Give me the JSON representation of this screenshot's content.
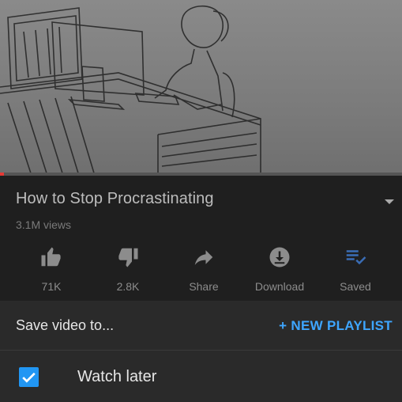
{
  "video": {
    "progress_percent": 1
  },
  "title": "How to Stop Procrastinating",
  "views": "3.1M views",
  "actions": [
    {
      "icon": "thumbs-up-icon",
      "label": "71K"
    },
    {
      "icon": "thumbs-down-icon",
      "label": "2.8K"
    },
    {
      "icon": "share-icon",
      "label": "Share"
    },
    {
      "icon": "download-icon",
      "label": "Download"
    },
    {
      "icon": "saved-playlist-icon",
      "label": "Saved"
    }
  ],
  "save_sheet": {
    "title": "Save video to...",
    "new_playlist_label": "+ NEW PLAYLIST",
    "playlists": [
      {
        "label": "Watch later",
        "checked": true
      }
    ]
  }
}
